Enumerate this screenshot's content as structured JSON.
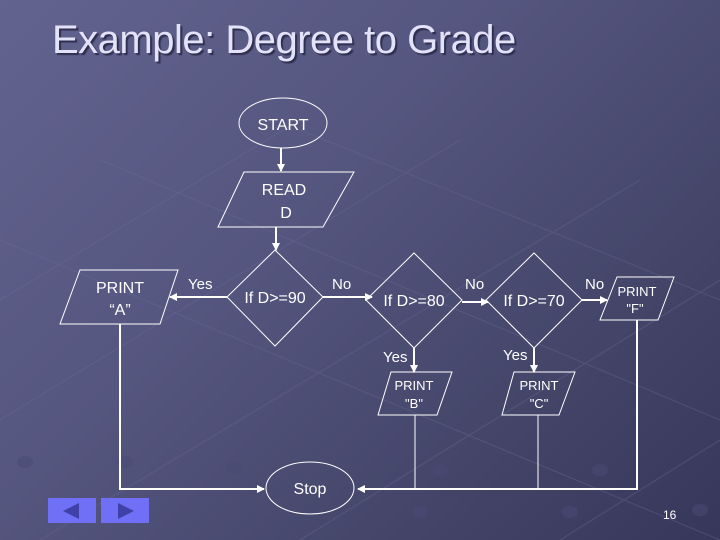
{
  "slide": {
    "title": "Example: Degree to Grade",
    "page_number": "16"
  },
  "flowchart": {
    "start": "START",
    "read": [
      "READ",
      "D"
    ],
    "decisions": [
      {
        "label": "If D>=90",
        "yes": "Yes",
        "no": "No"
      },
      {
        "label": "If D>=80",
        "yes": "Yes",
        "no": "No"
      },
      {
        "label": "If D>=70",
        "yes": "Yes",
        "no": "No"
      }
    ],
    "outputs": {
      "A": [
        "PRINT",
        "“A”"
      ],
      "B": [
        "PRINT",
        "\"B\""
      ],
      "C": [
        "PRINT",
        "\"C\""
      ],
      "F": [
        "PRINT",
        "\"F\""
      ]
    },
    "stop": "Stop"
  },
  "navigation": {
    "prev_icon": "previous-slide-icon",
    "next_icon": "next-slide-icon"
  },
  "colors": {
    "nav_button": "#6f70f5",
    "nav_arrow": "#3f40a8",
    "title_text": "#e4e2f8"
  }
}
